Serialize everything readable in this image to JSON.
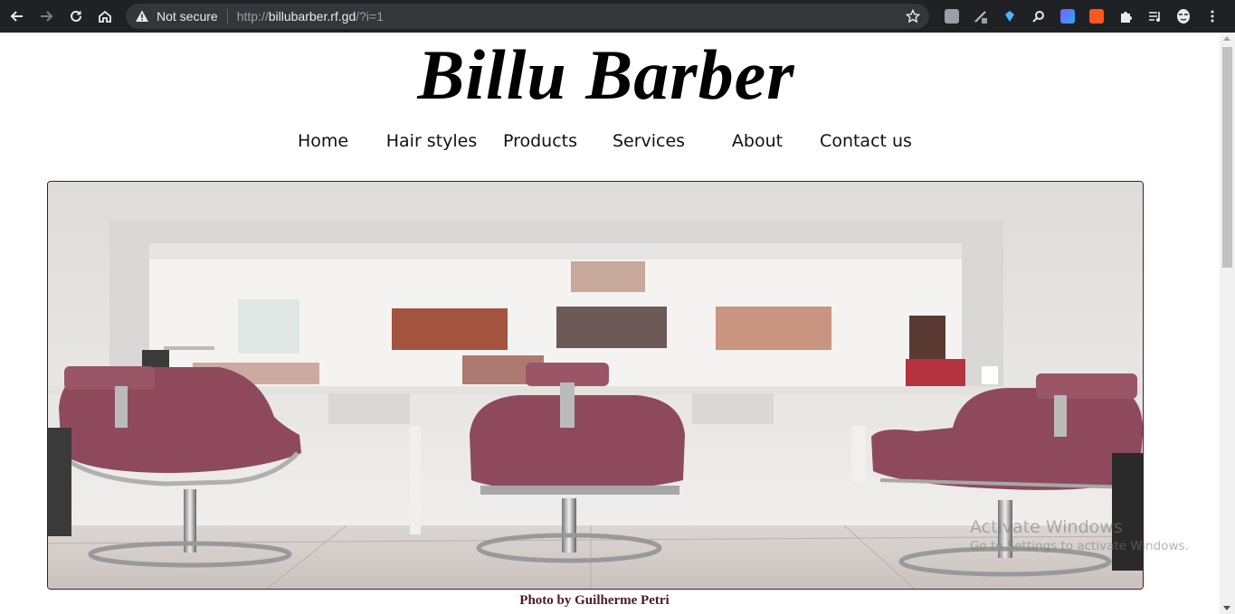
{
  "browser": {
    "security_label": "Not secure",
    "url_prefix": "http://",
    "url_host": "billubarber.rf.gd",
    "url_path": "/?i=1",
    "icons": [
      "back-icon",
      "forward-icon",
      "reload-icon",
      "home-icon",
      "warning-icon",
      "bookmark-star-icon",
      "extension-icon",
      "puzzle-icon",
      "media-icon",
      "profile-icon",
      "menu-icon"
    ]
  },
  "site": {
    "title": "Billu Barber",
    "nav": [
      {
        "label": "Home"
      },
      {
        "label": "Hair styles"
      },
      {
        "label": "Products"
      },
      {
        "label": "Services"
      },
      {
        "label": "About"
      },
      {
        "label": "Contact us"
      }
    ],
    "photo_caption": "Photo by Guilherme Petri",
    "chair_color": "#8e4a5c",
    "border_color": "#5a1020"
  },
  "watermark": {
    "line1": "Activate Windows",
    "line2": "Go to Settings to activate Windows."
  }
}
